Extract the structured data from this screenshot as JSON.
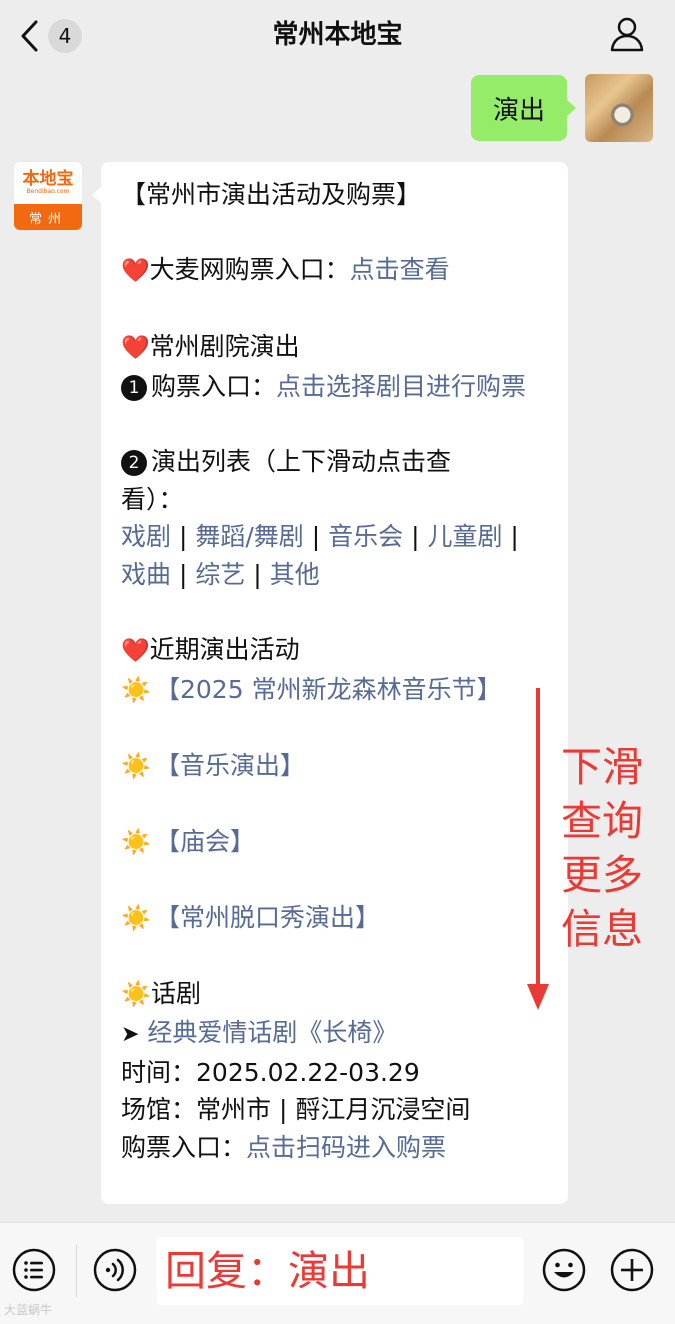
{
  "header": {
    "title": "常州本地宝",
    "unread_count": "4"
  },
  "outgoing": {
    "text": "演出"
  },
  "incoming": {
    "avatar": {
      "brand": "本地宝",
      "url": "Bendibao.com",
      "city": "常州"
    },
    "heading": "【常州市演出活动及购票】",
    "damai": {
      "prefix": "❤️",
      "label": "大麦网购票入口：",
      "link": "点击查看"
    },
    "theater": {
      "prefix": "❤️",
      "title": "常州剧院演出",
      "item1_num": "❶",
      "item1_label": "购票入口：",
      "item1_link": "点击选择剧目进行购票",
      "item2_num": "❷",
      "item2_label": "演出列表（上下滑动点击查看）：",
      "categories": [
        "戏剧",
        "舞蹈/舞剧",
        "音乐会",
        "儿童剧",
        "戏曲",
        "综艺",
        "其他"
      ],
      "separator": " | "
    },
    "recent": {
      "prefix": "❤️",
      "title": "近期演出活动",
      "sun": "☀️",
      "events": [
        "【2025 常州新龙森林音乐节】",
        "【音乐演出】",
        "【庙会】",
        "【常州脱口秀演出】"
      ]
    },
    "drama": {
      "prefix": "☀️",
      "title": "话剧",
      "arrow": "➤",
      "show_link": "经典爱情话剧《长椅》",
      "time_label": "时间：",
      "time_value": "2025.02.22-03.29",
      "venue_label": "场馆：",
      "venue_value": "常州市 | 酹江月沉浸空间",
      "ticket_label": "购票入口：",
      "ticket_link": "点击扫码进入购票"
    }
  },
  "annotation": {
    "lines": [
      "下滑",
      "查询",
      "更多",
      "信息"
    ]
  },
  "input_bar": {
    "reply_hint": "回复：演出",
    "watermark": "大蓝蜗牛"
  },
  "icons": {
    "back": "chevron-left-icon",
    "profile": "person-icon",
    "menu": "list-menu-icon",
    "voice": "voice-icon",
    "emoji": "smiley-icon",
    "plus": "plus-icon"
  },
  "colors": {
    "bubble_out": "#95ec69",
    "link": "#576b95",
    "annotation": "#ea3a35",
    "brand": "#f26a10"
  }
}
